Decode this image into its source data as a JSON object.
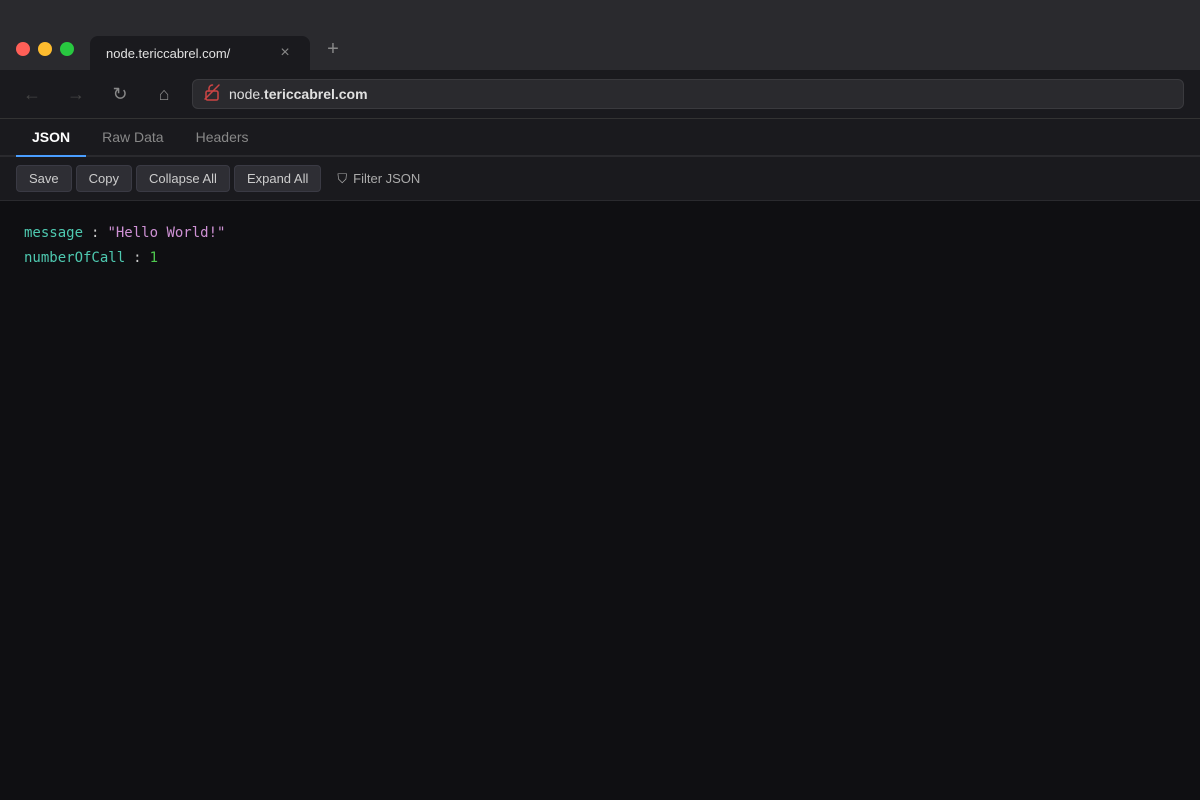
{
  "browser": {
    "tab": {
      "title": "node.tericcabrel.com/",
      "close_icon": "×",
      "new_tab_icon": "+"
    },
    "nav": {
      "back_icon": "←",
      "forward_icon": "→",
      "reload_icon": "↻",
      "home_icon": "⌂",
      "url_display": "node.tericcabrel.com",
      "url_bold_prefix": "node.",
      "url_bold_suffix": "tericcabrel.com",
      "lock_icon": "🔒"
    }
  },
  "json_viewer": {
    "tabs": [
      {
        "label": "JSON",
        "active": true
      },
      {
        "label": "Raw Data",
        "active": false
      },
      {
        "label": "Headers",
        "active": false
      }
    ],
    "toolbar": {
      "save_label": "Save",
      "copy_label": "Copy",
      "collapse_all_label": "Collapse All",
      "expand_all_label": "Expand All",
      "filter_icon": "⛉",
      "filter_label": "Filter JSON"
    },
    "data": {
      "rows": [
        {
          "key": "message",
          "value_type": "string",
          "value": "\"Hello World!\""
        },
        {
          "key": "numberOfCall",
          "value_type": "number",
          "value": "1"
        }
      ]
    }
  }
}
